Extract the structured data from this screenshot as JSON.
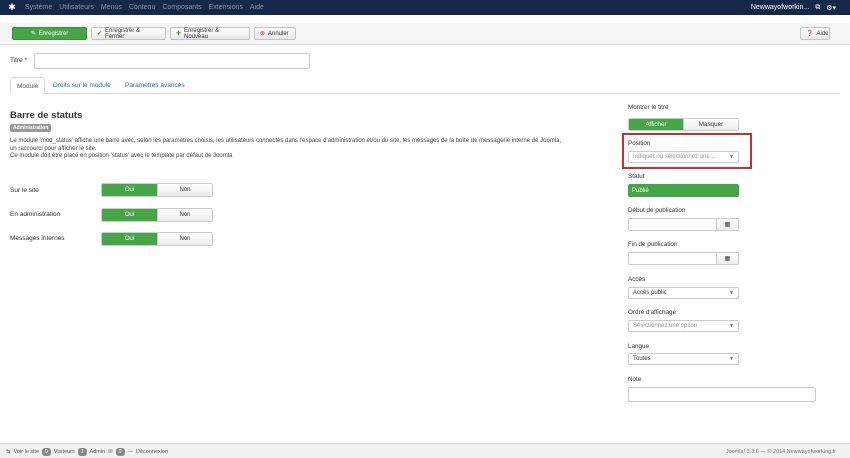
{
  "navbar": {
    "menu": [
      "Système",
      "Utilisateurs",
      "Menus",
      "Contenu",
      "Composants",
      "Extensions",
      "Aide"
    ],
    "site_name": "Newwayofworkin..."
  },
  "toolbar": {
    "save": "Enregistrer",
    "save_close": "Enregistrer & Fermer",
    "save_new": "Enregistrer & Nouveau",
    "cancel": "Annuler",
    "help": "Aide"
  },
  "form": {
    "title_label": "Titre *",
    "title_value": ""
  },
  "tabs": [
    "Module",
    "Droits sur le module",
    "Paramètres avancés"
  ],
  "module": {
    "name": "Barre de statuts",
    "badge": "Administration",
    "description_lines": [
      "Le module 'mod_status' affiche une barre avec, selon les paramètres choisis, les utilisateurs connectés dans l'espace d'administration et/ou du site, les messages de la boîte de messagerie interne de Joomla,",
      "un raccourci pour afficher le site.",
      "Ce module doit être placé en position 'status' avec le template par défaut de Joomla"
    ]
  },
  "options": [
    {
      "label": "Sur le site",
      "on": "Oui",
      "off": "Non"
    },
    {
      "label": "En administration",
      "on": "Oui",
      "off": "Non"
    },
    {
      "label": "Messages internes",
      "on": "Oui",
      "off": "Non"
    }
  ],
  "sidebar": {
    "show_title_label": "Montrer le titre",
    "show_label": "Afficher",
    "hide_label": "Masquer",
    "position_label": "Position",
    "position_placeholder": "Indiquer ou sélectionnez une ...",
    "status_label": "Statut",
    "status_value": "Publié",
    "publish_start_label": "Début de publication",
    "publish_end_label": "Fin de publication",
    "access_label": "Accès",
    "access_value": "Accès public",
    "ordering_label": "Ordre d'affichage",
    "ordering_placeholder": "Sélectionnez une option",
    "language_label": "Langue",
    "language_value": "Toutes",
    "note_label": "Note"
  },
  "footer": {
    "view_site": "Voir le site",
    "visitors_count": "0",
    "visitors_label": "Visiteurs",
    "admin_count": "1",
    "admin_label": "Admin",
    "messages_count": "0",
    "logout": "Déconnexion",
    "copyright": "Joomla! 3.3.6 — © 2014 Newwayofworking.fr"
  },
  "colors": {
    "navbar": "#16284a",
    "success": "#46a546",
    "highlight": "#c9302c",
    "link": "#2a69b8"
  }
}
